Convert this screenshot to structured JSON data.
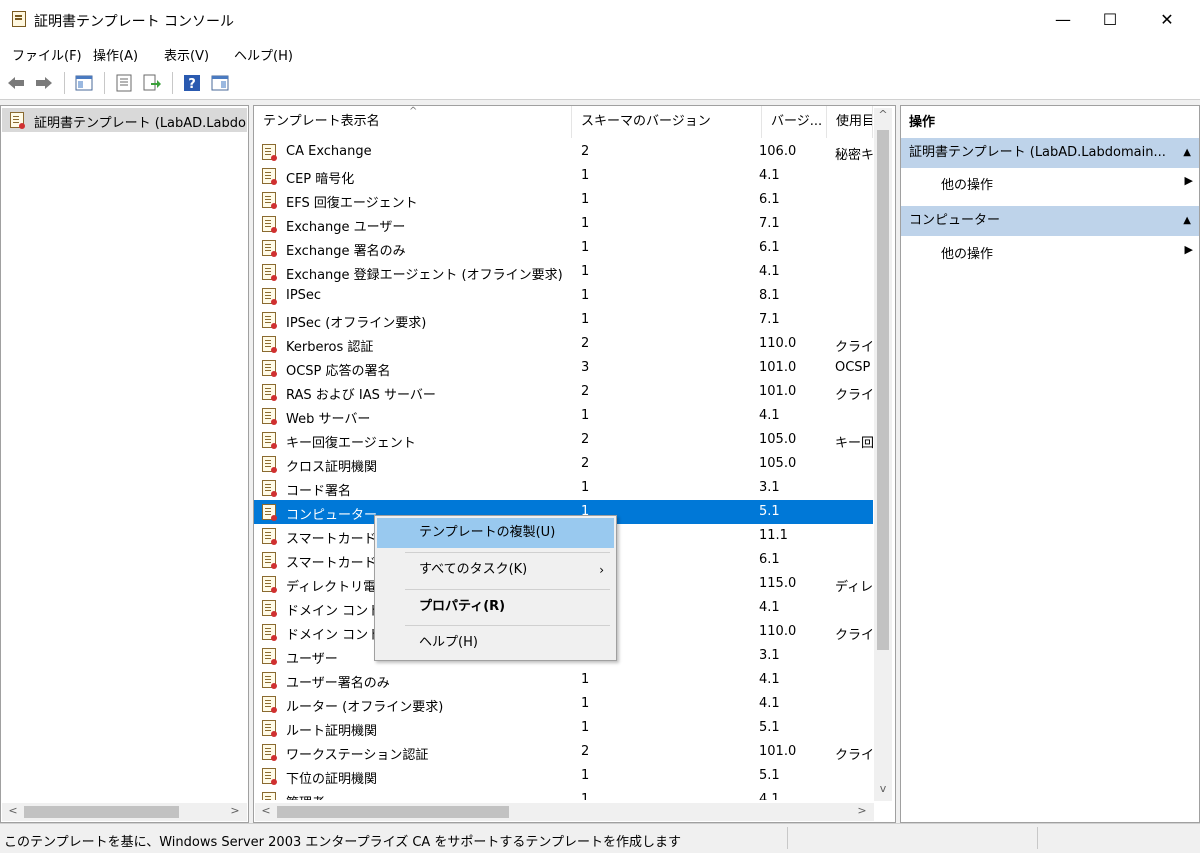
{
  "window": {
    "title": "証明書テンプレート コンソール",
    "minimize": "—",
    "maximize": "☐",
    "close": "✕"
  },
  "menu": [
    "ファイル(F)",
    "操作(A)",
    "表示(V)",
    "ヘルプ(H)"
  ],
  "toolbar": {
    "icons": [
      "back-arrow-icon",
      "forward-arrow-icon",
      "show-hide-console-tree-icon",
      "properties-icon",
      "export-list-icon",
      "help-icon",
      "show-hide-action-pane-icon"
    ]
  },
  "tree": {
    "root_label": "証明書テンプレート (LabAD.Labdomain"
  },
  "list": {
    "columns": [
      "テンプレート表示名",
      "スキーマのバージョン",
      "バージ...",
      "使用目"
    ],
    "rows": [
      {
        "name": "CA Exchange",
        "schema": "2",
        "version": "106.0",
        "purpose": "秘密キ"
      },
      {
        "name": "CEP 暗号化",
        "schema": "1",
        "version": "4.1",
        "purpose": ""
      },
      {
        "name": "EFS 回復エージェント",
        "schema": "1",
        "version": "6.1",
        "purpose": ""
      },
      {
        "name": "Exchange ユーザー",
        "schema": "1",
        "version": "7.1",
        "purpose": ""
      },
      {
        "name": "Exchange 署名のみ",
        "schema": "1",
        "version": "6.1",
        "purpose": ""
      },
      {
        "name": "Exchange 登録エージェント (オフライン要求)",
        "schema": "1",
        "version": "4.1",
        "purpose": ""
      },
      {
        "name": "IPSec",
        "schema": "1",
        "version": "8.1",
        "purpose": ""
      },
      {
        "name": "IPSec (オフライン要求)",
        "schema": "1",
        "version": "7.1",
        "purpose": ""
      },
      {
        "name": "Kerberos 認証",
        "schema": "2",
        "version": "110.0",
        "purpose": "クライア"
      },
      {
        "name": "OCSP 応答の署名",
        "schema": "3",
        "version": "101.0",
        "purpose": "OCSP"
      },
      {
        "name": "RAS および IAS サーバー",
        "schema": "2",
        "version": "101.0",
        "purpose": "クライア"
      },
      {
        "name": "Web サーバー",
        "schema": "1",
        "version": "4.1",
        "purpose": ""
      },
      {
        "name": "キー回復エージェント",
        "schema": "2",
        "version": "105.0",
        "purpose": "キー回"
      },
      {
        "name": "クロス証明機関",
        "schema": "2",
        "version": "105.0",
        "purpose": ""
      },
      {
        "name": "コード署名",
        "schema": "1",
        "version": "3.1",
        "purpose": ""
      },
      {
        "name": "コンピューター",
        "schema": "1",
        "version": "5.1",
        "purpose": ""
      },
      {
        "name": "スマートカードユ",
        "schema": "",
        "version": "11.1",
        "purpose": ""
      },
      {
        "name": "スマートカードロ",
        "schema": "",
        "version": "6.1",
        "purpose": ""
      },
      {
        "name": "ディレクトリ電子",
        "schema": "",
        "version": "115.0",
        "purpose": "ディレク"
      },
      {
        "name": "ドメイン コントロ",
        "schema": "",
        "version": "4.1",
        "purpose": ""
      },
      {
        "name": "ドメイン コントロ",
        "schema": "",
        "version": "110.0",
        "purpose": "クライア"
      },
      {
        "name": "ユーザー",
        "schema": "",
        "version": "3.1",
        "purpose": ""
      },
      {
        "name": "ユーザー署名のみ",
        "schema": "1",
        "version": "4.1",
        "purpose": ""
      },
      {
        "name": "ルーター (オフライン要求)",
        "schema": "1",
        "version": "4.1",
        "purpose": ""
      },
      {
        "name": "ルート証明機関",
        "schema": "1",
        "version": "5.1",
        "purpose": ""
      },
      {
        "name": "ワークステーション認証",
        "schema": "2",
        "version": "101.0",
        "purpose": "クライア"
      },
      {
        "name": "下位の証明機関",
        "schema": "1",
        "version": "5.1",
        "purpose": ""
      },
      {
        "name": "管理者",
        "schema": "1",
        "version": "4.1",
        "purpose": ""
      }
    ],
    "selected_index": 15
  },
  "actions": {
    "header": "操作",
    "sections": [
      {
        "title": "証明書テンプレート (LabAD.Labdomain...",
        "item": "他の操作"
      },
      {
        "title": "コンピューター",
        "item": "他の操作"
      }
    ]
  },
  "context_menu": {
    "items": [
      "テンプレートの複製(U)",
      "すべてのタスク(K)",
      "プロパティ(R)",
      "ヘルプ(H)"
    ]
  },
  "status": {
    "text": "このテンプレートを基に、Windows Server 2003 エンタープライズ CA をサポートするテンプレートを作成します"
  },
  "colors": {
    "selection": "#0078d7",
    "context_highlight": "#99c9ef",
    "action_section": "#bed3ea"
  }
}
